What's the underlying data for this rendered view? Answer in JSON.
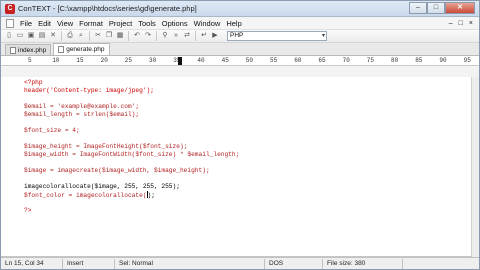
{
  "window": {
    "title": "ConTEXT - [C:\\xampp\\htdocs\\series\\gd\\generate.php]",
    "app_icon": "C",
    "controls": {
      "minimize": "–",
      "maximize": "□",
      "close": "✕"
    }
  },
  "menu": {
    "items": [
      "File",
      "Edit",
      "View",
      "Format",
      "Project",
      "Tools",
      "Options",
      "Window",
      "Help"
    ],
    "right_controls": [
      "–",
      "□",
      "×"
    ]
  },
  "toolbar": {
    "language": "PHP"
  },
  "tabs": [
    {
      "label": "index.php",
      "active": false
    },
    {
      "label": "generate.php",
      "active": true
    }
  ],
  "ruler": {
    "labels": [
      "5",
      "10",
      "15",
      "20",
      "25",
      "30",
      "35",
      "40",
      "45",
      "50",
      "55",
      "60",
      "65",
      "70",
      "75",
      "80",
      "85",
      "90",
      "95"
    ]
  },
  "code": {
    "lines": [
      "<?php",
      "header('Content-type: image/jpeg');",
      "",
      "$email = 'example@example.com';",
      "$email_length = strlen($email);",
      "",
      "$font_size = 4;",
      "",
      "$image_height = ImageFontHeight($font_size);",
      "$image_width = ImageFontWidth($font_size) * $email_length;",
      "",
      "$image = imagecreate($image_width, $image_height);",
      "",
      "imagecolorallocate($image, 255, 255, 255);",
      "$font_color = imagecolorallocate(",
      "",
      "?>"
    ],
    "caret_line_suffix": ");"
  },
  "status": {
    "position": "Ln 15, Col 34",
    "mode": "Insert",
    "block": "Sel: Normal",
    "format": "DOS",
    "size": "File size: 380"
  },
  "colors": {
    "titlebar": "#c9d9ec",
    "code_string": "#cc0000",
    "code_variable": "#b22222"
  }
}
